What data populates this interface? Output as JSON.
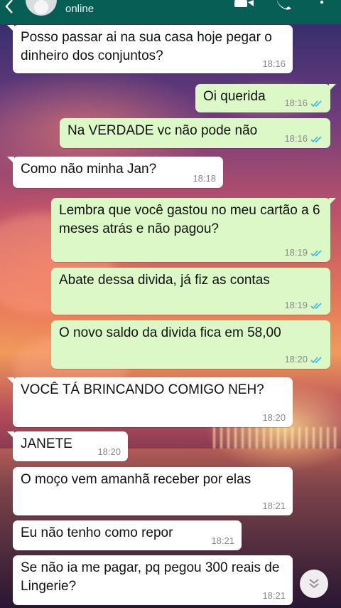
{
  "header": {
    "status": "online",
    "icons": [
      "back-arrow-icon",
      "avatar",
      "video-call-icon",
      "voice-call-icon",
      "more-options-icon"
    ]
  },
  "colors": {
    "header": "#075e54",
    "incoming_bubble": "#ffffff",
    "outgoing_bubble": "#dcf8c6",
    "read_ticks": "#34b7f1"
  },
  "messages": [
    {
      "dir": "in",
      "text": "Posso passar ai na sua casa hoje pegar o dinheiro dos conjuntos?",
      "time": "18:16"
    },
    {
      "dir": "out",
      "text": "Oi querida",
      "time": "18:16",
      "read": true
    },
    {
      "dir": "out",
      "text": "Na VERDADE vc não pode não",
      "time": "18:16",
      "read": true
    },
    {
      "dir": "in",
      "text": "Como não minha Jan?",
      "time": "18:18"
    },
    {
      "dir": "out",
      "text": "Lembra que você gastou no meu cartão a 6 meses atrás e não pagou?",
      "time": "18:19",
      "read": true
    },
    {
      "dir": "out",
      "text": "Abate dessa divida, já fiz as contas",
      "time": "18:19",
      "read": true
    },
    {
      "dir": "out",
      "text": "O novo saldo da divida fica em 58,00",
      "time": "18:20",
      "read": true
    },
    {
      "dir": "in",
      "text": "VOCÊ TÁ BRINCANDO COMIGO NEH?",
      "time": "18:20"
    },
    {
      "dir": "in",
      "text": "JANETE",
      "time": "18:20"
    },
    {
      "dir": "in",
      "text": "O moço vem amanhã receber por elas",
      "time": "18:21"
    },
    {
      "dir": "in",
      "text": "Eu não tenho como repor",
      "time": "18:21"
    },
    {
      "dir": "in",
      "text": "Se não ia me pagar, pq pegou 300 reais de Lingerie?",
      "time": "18:21"
    }
  ]
}
